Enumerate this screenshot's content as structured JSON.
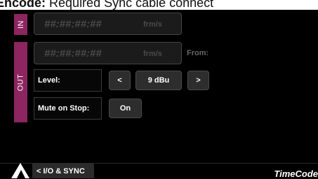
{
  "banner": {
    "bold": "Encode:",
    "text": "Required Sync cable connect"
  },
  "in_section": {
    "tag": "IN",
    "timecode": "##:##:##:##",
    "unit": "frm/s"
  },
  "out_section": {
    "tag": "OUT",
    "timecode": "##:##:##:##",
    "unit": "frm/s",
    "from_label": "From:",
    "level": {
      "label": "Level:",
      "decrement": "<",
      "value": "9 dBu",
      "increment": ">"
    },
    "mute_on_stop": {
      "label": "Mute on Stop:",
      "value": "On"
    }
  },
  "footer": {
    "back_label": "< I/O & SYNC",
    "title": "TimeCode",
    "back_icon": "triangle-up-icon"
  },
  "colors": {
    "accent": "#8c2560"
  }
}
